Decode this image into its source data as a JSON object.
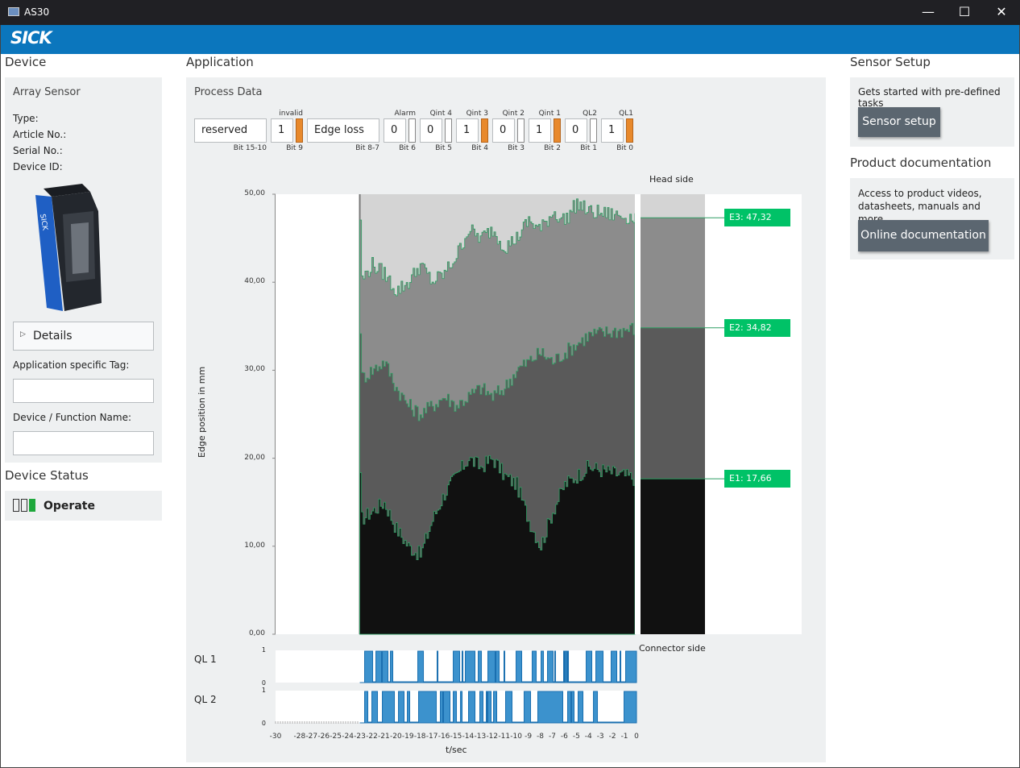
{
  "window": {
    "title": "AS30"
  },
  "brand": {
    "logo": "SICK",
    "color": "#0b76bd"
  },
  "device": {
    "heading": "Device",
    "sensor_name": "Array Sensor",
    "info_labels": [
      "Type:",
      "Article No.:",
      "Serial No.:",
      "Device ID:"
    ],
    "details_label": "Details",
    "app_tag_label": "Application specific Tag:",
    "app_tag_value": "",
    "function_name_label": "Device / Function Name:",
    "function_name_value": ""
  },
  "device_status": {
    "heading": "Device Status",
    "status": "Operate"
  },
  "application": {
    "heading": "Application",
    "process_data_title": "Process Data",
    "fields": [
      {
        "top": "",
        "value": "reserved",
        "bottom": "Bit 15-10"
      },
      {
        "top": "invalid",
        "value": "1",
        "bottom": "Bit 9",
        "flag": true
      },
      {
        "top": "",
        "value": "Edge loss",
        "bottom": "Bit 8-7"
      },
      {
        "top": "Alarm",
        "value": "0",
        "bottom": "Bit 6",
        "flag": false
      },
      {
        "top": "Qint 4",
        "value": "0",
        "bottom": "Bit 5",
        "flag": false
      },
      {
        "top": "Qint 3",
        "value": "1",
        "bottom": "Bit 4",
        "flag": true
      },
      {
        "top": "Qint 2",
        "value": "0",
        "bottom": "Bit 3",
        "flag": false
      },
      {
        "top": "Qint 1",
        "value": "1",
        "bottom": "Bit 2",
        "flag": true
      },
      {
        "top": "QL2",
        "value": "0",
        "bottom": "Bit 1",
        "flag": false
      },
      {
        "top": "QL1",
        "value": "1",
        "bottom": "Bit 0",
        "flag": true
      }
    ]
  },
  "chart_data": {
    "type": "area",
    "ylabel": "Edge position in mm",
    "xlabel": "t/sec",
    "ylim": [
      0,
      50
    ],
    "y_ticks": [
      "50,00",
      "40,00",
      "30,00",
      "20,00",
      "10,00",
      "0,00"
    ],
    "x_ticks": [
      "-30",
      "-28",
      "-27",
      "-26",
      "-25",
      "-24",
      "-23",
      "-22",
      "-21",
      "-20",
      "-19",
      "-18",
      "-17",
      "-16",
      "-15",
      "-14",
      "-13",
      "-12",
      "-11",
      "-10",
      "-9",
      "-8",
      "-7",
      "-6",
      "-5",
      "-4",
      "-3",
      "-2",
      "-1",
      "0"
    ],
    "head_side_label": "Head side",
    "connector_side_label": "Connector side",
    "data_start_t": -23,
    "series": [
      {
        "name": "E1",
        "values": [
          13,
          14,
          15,
          12,
          10,
          9,
          13,
          16,
          18,
          20,
          19,
          20,
          18,
          17,
          13,
          10,
          14,
          17,
          18,
          19
        ],
        "t": [
          -23,
          -22,
          -21,
          -20,
          -19,
          -18,
          -17,
          -16,
          -15,
          -14,
          -13,
          -12,
          -11,
          -10,
          -9,
          -8,
          -7,
          -6,
          -5,
          -4
        ]
      },
      {
        "name": "E2",
        "values": [
          29,
          30,
          31,
          28,
          26,
          25,
          26,
          27,
          26,
          27,
          28,
          27,
          28,
          30,
          31,
          32,
          31,
          32,
          33,
          34
        ],
        "t": [
          -23,
          -22,
          -21,
          -20,
          -19,
          -18,
          -17,
          -16,
          -15,
          -14,
          -13,
          -12,
          -11,
          -10,
          -9,
          -8,
          -7,
          -6,
          -5,
          -4
        ]
      },
      {
        "name": "E3",
        "values": [
          40,
          42,
          41,
          39,
          40,
          42,
          40,
          41,
          43,
          46,
          45,
          46,
          44,
          45,
          47,
          46,
          48,
          47,
          49,
          48
        ],
        "t": [
          -23,
          -22,
          -21,
          -20,
          -19,
          -18,
          -17,
          -16,
          -15,
          -14,
          -13,
          -12,
          -11,
          -10,
          -9,
          -8,
          -7,
          -6,
          -5,
          -4
        ]
      }
    ],
    "edge_labels": [
      "E3: 47,32 mm",
      "E2: 34,82 mm",
      "E1: 17,66 mm"
    ],
    "edge_values": [
      47.32,
      34.82,
      17.66
    ],
    "ql": [
      {
        "name": "QL 1",
        "y_ticks": [
          "1",
          "0"
        ]
      },
      {
        "name": "QL 2",
        "y_ticks": [
          "1",
          "0"
        ]
      }
    ]
  },
  "sensor_setup": {
    "heading": "Sensor Setup",
    "description": "Gets started with pre-defined tasks",
    "button_label": "Sensor setup"
  },
  "product_documentation": {
    "heading": "Product documentation",
    "description": "Access to product videos, datasheets, manuals and more",
    "button_label": "Online documentation"
  }
}
